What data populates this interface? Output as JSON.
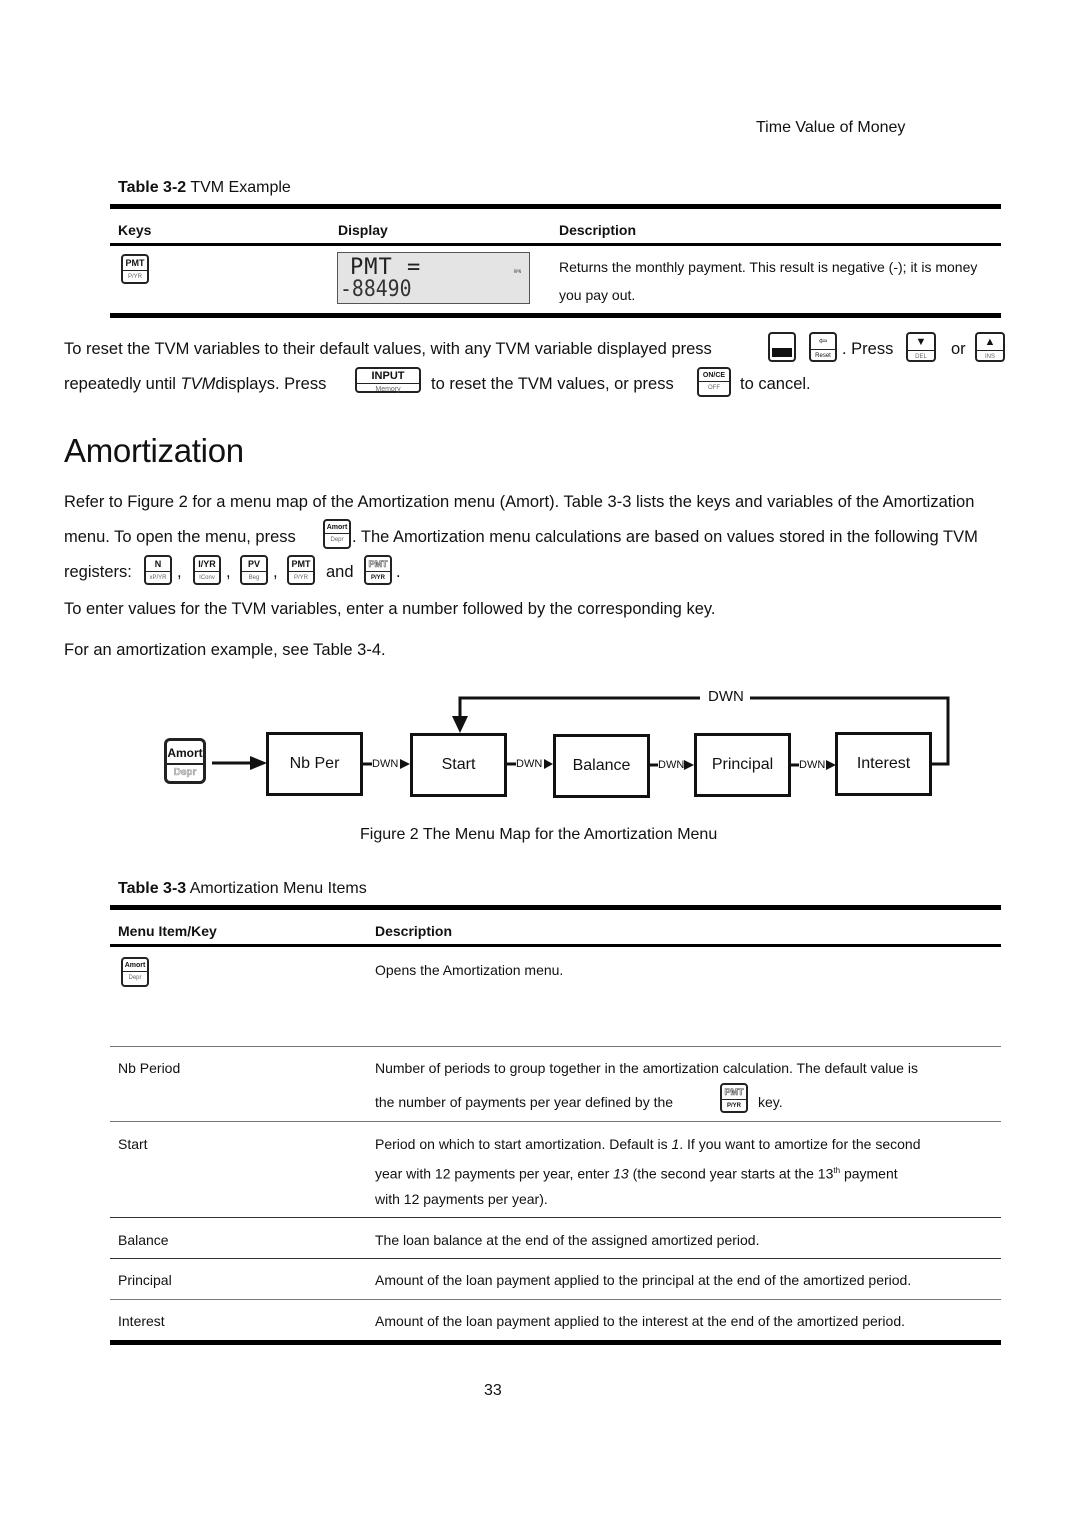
{
  "header": {
    "running_head": "Time Value of Money"
  },
  "table_3_2": {
    "caption_num": "Table 3-2",
    "caption_title": "TVM Example",
    "columns": [
      "Keys",
      "Display",
      "Description"
    ],
    "rows": [
      {
        "key": {
          "top": "PMT",
          "bottom": "P/YR"
        },
        "display": {
          "line1": "PMT =",
          "line2": "-88490",
          "annunciator": "RPN"
        },
        "description": "Returns the monthly payment. This result is negative (-); it is money you pay out."
      }
    ]
  },
  "reset_paragraph": {
    "part1": "To reset the TVM variables to their default values, with any TVM variable displayed press",
    "part2": ". Press",
    "part3": "or",
    "part4": "repeatedly until",
    "part4_italic": "TVM",
    "part5": "displays. Press",
    "part6": "to reset the TVM values, or press",
    "part7": "to cancel.",
    "keys": {
      "shift": {
        "top": "",
        "bottom": ""
      },
      "reset": {
        "top": "⇦",
        "bottom": "Reset"
      },
      "down": {
        "top": "▼",
        "bottom": "DEL"
      },
      "up": {
        "top": "▲",
        "bottom": "INS"
      },
      "input": {
        "top": "INPUT",
        "bottom": "Memory"
      },
      "on": {
        "top": "ON/CE",
        "bottom": "OFF"
      }
    }
  },
  "section": {
    "heading": "Amortization",
    "para1_line1": "Refer to Figure 2 for a menu map of the Amortization menu (Amort). Table 3-3 lists the keys and variables of the Amortization",
    "para1_line2a": "menu. To open the menu, press",
    "para1_line2b": ". The Amortization menu calculations are based on values stored in the following TVM",
    "para1_line3a": "registers:",
    "para1_and": "and",
    "comma": ",",
    "period": ".",
    "register_keys": [
      {
        "top": "N",
        "bottom": "xP/YR"
      },
      {
        "top": "I/YR",
        "bottom": "IConv"
      },
      {
        "top": "PV",
        "bottom": "Beg"
      },
      {
        "top": "PMT",
        "bottom": "P/YR"
      },
      {
        "top": "PMT",
        "bottom": "P/YR"
      }
    ],
    "amort_key": {
      "top": "Amort",
      "bottom": "Depr"
    },
    "para2": "To enter values for the TVM variables, enter a number followed by the corresponding key.",
    "para3": "For an amortization example, see Table 3-4."
  },
  "figure_2": {
    "start_key": {
      "top": "Amort",
      "bottom": "Depr"
    },
    "nodes": [
      "Nb Per",
      "Start",
      "Balance",
      "Principal",
      "Interest"
    ],
    "edge_label": "DWN",
    "loop_label": "DWN",
    "caption": "Figure 2 The Menu Map for the Amortization Menu"
  },
  "table_3_3": {
    "caption_num": "Table 3-3",
    "caption_title": "Amortization Menu Items",
    "columns": [
      "Menu Item/Key",
      "Description"
    ],
    "rows": [
      {
        "item": "",
        "key": {
          "top": "Amort",
          "bottom": "Depr"
        },
        "description": "Opens the Amortization menu."
      },
      {
        "item": "Nb Period",
        "description_a": "Number of periods to group together in the amortization calculation. The default value is",
        "description_b": "the number of payments per year defined by the",
        "description_c": "key.",
        "key": {
          "top": "PMT",
          "bottom": "P/YR"
        }
      },
      {
        "item": "Start",
        "description_a": "Period on which to start amortization. Default is",
        "italic_1": "1",
        "description_b": ". If you want to amortize for the second",
        "description_c": "year with 12 payments per year, enter",
        "italic_13": "13",
        "description_d": "(the second year starts at the 13",
        "sup": "th",
        "description_e": "payment",
        "description_f": "with 12 payments per year)."
      },
      {
        "item": "Balance",
        "description": "The loan balance at the end of the assigned amortized period."
      },
      {
        "item": "Principal",
        "description": "Amount of the loan payment applied to the principal at the end of the amortized period."
      },
      {
        "item": "Interest",
        "description": "Amount of the loan payment applied to the interest at the end of the amortized period."
      }
    ]
  },
  "footer": {
    "page_number": "33"
  }
}
